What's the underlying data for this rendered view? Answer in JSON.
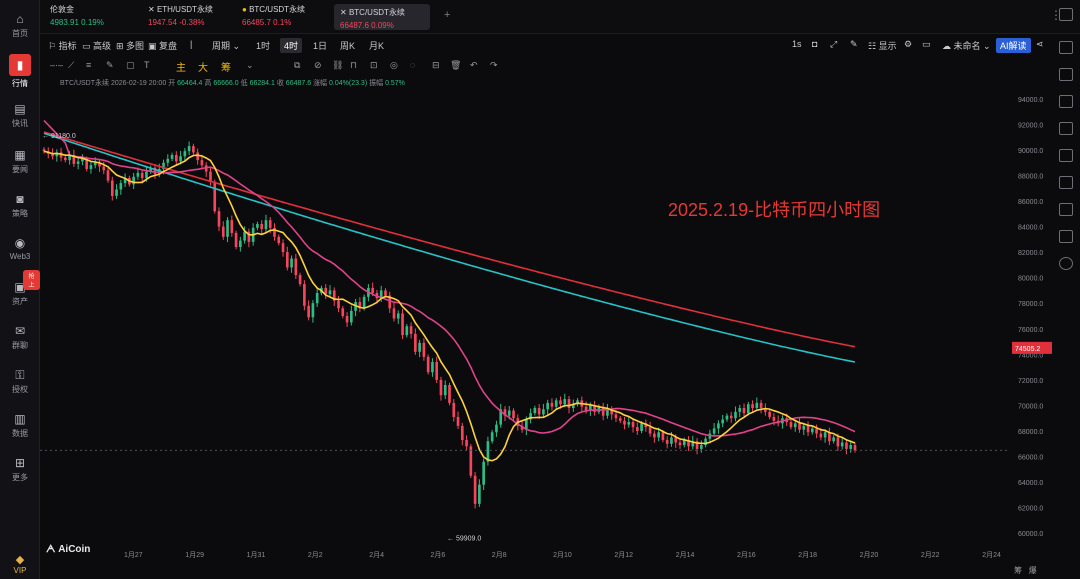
{
  "sidebar": {
    "items": [
      {
        "label": "首页",
        "icon": "home-icon"
      },
      {
        "label": "行情",
        "icon": "chart-bars-icon"
      },
      {
        "label": "快讯",
        "icon": "flash-news-icon"
      },
      {
        "label": "要闻",
        "icon": "news-icon"
      },
      {
        "label": "策略",
        "icon": "robot-icon"
      },
      {
        "label": "Web3",
        "icon": "web3-icon"
      },
      {
        "label": "资产",
        "icon": "wallet-icon"
      },
      {
        "label": "群聊",
        "icon": "chat-icon"
      },
      {
        "label": "授权",
        "icon": "key-icon"
      },
      {
        "label": "数据",
        "icon": "data-icon"
      },
      {
        "label": "更多",
        "icon": "grid-icon"
      }
    ],
    "new_badge": "抢上",
    "vip": "VIP"
  },
  "tickers": [
    {
      "name": "伦敦金",
      "price": "4983.91",
      "change": "0.19%"
    },
    {
      "name": "ETH/USDT永续",
      "price": "1947.54",
      "change": "-0.38%"
    },
    {
      "name": "BTC/USDT永续",
      "price": "66485.7",
      "change": "0.1%"
    },
    {
      "name": "BTC/USDT永续",
      "price": "66487.6",
      "change": "0.09%"
    }
  ],
  "toolbar": {
    "indicator": "指标",
    "advanced": "高级",
    "multi_chart": "多图",
    "replay": "复盘",
    "period": "周期",
    "intervals": [
      "1时",
      "4时",
      "1日",
      "周K",
      "月K"
    ],
    "active_interval": "4时",
    "refresh": "1s",
    "display": "显示",
    "unnamed": "未命名",
    "ai": "AI解读"
  },
  "drawtools": {
    "zhu": "主",
    "da": "大",
    "chou": "筹"
  },
  "info": {
    "symbol": "BTC/USDT永续",
    "time": "2026-02-19 20:00",
    "open_label": "开",
    "open": "66464.4",
    "high_label": "高",
    "high": "66666.0",
    "low_label": "低",
    "low": "66284.1",
    "close_label": "收",
    "close": "66487.6",
    "change_label": "涨幅",
    "change": "0.04%(23.3)",
    "amp_label": "振幅",
    "amp": "0.57%"
  },
  "annotation": "2025.2.19-比特币四小时图",
  "logo": "AiCoin",
  "bottom": {
    "left": "筹",
    "right": "爆"
  },
  "chart_data": {
    "type": "candlestick",
    "ylim": [
      59000,
      95000
    ],
    "y_ticks": [
      "94000.0",
      "92000.0",
      "90000.0",
      "88000.0",
      "86000.0",
      "84000.0",
      "82000.0",
      "80000.0",
      "78000.0",
      "76000.0",
      "74000.0",
      "72000.0",
      "70000.0",
      "68000.0",
      "66000.0",
      "64000.0",
      "62000.0",
      "60000.0"
    ],
    "x_ticks": [
      "1月27",
      "1月29",
      "1月31",
      "2月2",
      "2月4",
      "2月6",
      "2月8",
      "2月10",
      "2月12",
      "2月14",
      "2月16",
      "2月18",
      "2月20",
      "2月22",
      "2月24"
    ],
    "max_label": "91180.0",
    "min_label": "59909.0",
    "current_price_label": "74505.2",
    "colors": {
      "up": "#2ebd85",
      "down": "#f6465d",
      "ma_short": "#ffd23c",
      "ma_mid": "#e0438a",
      "ma_long_a": "#27c2c8",
      "ma_long_b": "#e0303b"
    },
    "candles_close": [
      89900,
      89700,
      89500,
      89800,
      89400,
      89200,
      89600,
      88900,
      89100,
      89300,
      88500,
      88800,
      89000,
      88700,
      88400,
      87600,
      86400,
      86900,
      87400,
      87800,
      87300,
      87900,
      88200,
      87800,
      88300,
      88600,
      88100,
      88500,
      89000,
      89300,
      89600,
      89100,
      89500,
      89900,
      90300,
      89800,
      89200,
      88800,
      88300,
      87500,
      85200,
      84000,
      83200,
      84500,
      83500,
      82400,
      82900,
      83600,
      82800,
      83900,
      84200,
      83800,
      84500,
      83900,
      83200,
      82700,
      82000,
      80800,
      81500,
      80200,
      79500,
      77800,
      76900,
      78000,
      78800,
      79200,
      78700,
      79000,
      78200,
      77600,
      77000,
      76500,
      77400,
      78100,
      77600,
      78500,
      79200,
      78800,
      78400,
      79000,
      78600,
      77600,
      76800,
      77200,
      75500,
      76200,
      75600,
      74200,
      74900,
      73800,
      72600,
      73400,
      72000,
      70800,
      71600,
      70200,
      69100,
      68400,
      67300,
      66800,
      64500,
      62300,
      63800,
      65600,
      67200,
      67900,
      68500,
      69700,
      69200,
      69600,
      69000,
      68400,
      68100,
      68900,
      69400,
      69800,
      69300,
      69700,
      70200,
      69900,
      70400,
      70100,
      70500,
      69800,
      70100,
      70400,
      69900,
      69600,
      70000,
      69500,
      69900,
      69200,
      69700,
      69300,
      69000,
      68800,
      68500,
      68700,
      68300,
      68000,
      68600,
      68300,
      67800,
      67500,
      67900,
      67300,
      67000,
      67500,
      67100,
      66900,
      67300,
      66800,
      67200,
      66600,
      66900,
      67400,
      67800,
      68200,
      68600,
      68900,
      69200,
      69000,
      69500,
      69800,
      69400,
      70100,
      69800,
      70200,
      69800,
      69500,
      69100,
      68800,
      68600,
      69000,
      68700,
      68300,
      68600,
      68100,
      68400,
      67900,
      68200,
      67800,
      67500,
      67900,
      67200,
      67500,
      66800,
      67100,
      66600,
      66900,
      66487
    ]
  }
}
